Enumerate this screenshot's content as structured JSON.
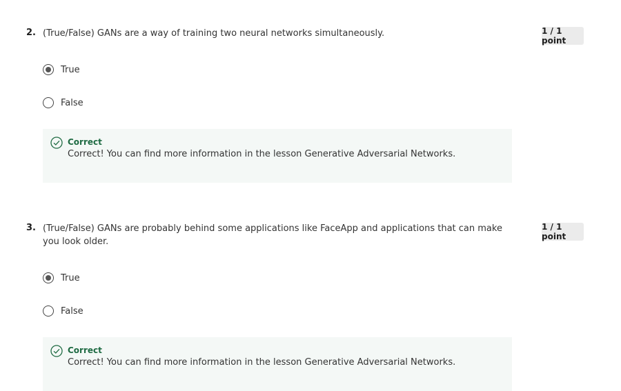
{
  "questions": [
    {
      "number": "2.",
      "text": "(True/False) GANs are a way of training two neural networks simultaneously.",
      "points": "1 / 1 point",
      "options": [
        {
          "label": "True",
          "selected": true
        },
        {
          "label": "False",
          "selected": false
        }
      ],
      "feedback": {
        "title": "Correct",
        "text": "Correct! You can find more information in the lesson Generative Adversarial Networks."
      }
    },
    {
      "number": "3.",
      "text": "(True/False) GANs are probably behind some applications like FaceApp and applications that can make you look older.",
      "points": "1 / 1 point",
      "options": [
        {
          "label": "True",
          "selected": true
        },
        {
          "label": "False",
          "selected": false
        }
      ],
      "feedback": {
        "title": "Correct",
        "text": "Correct! You can find more information in the lesson Generative Adversarial Networks."
      }
    }
  ],
  "colors": {
    "correct_green": "#1f6b43",
    "feedback_bg": "#f4f8f6",
    "points_bg": "#ebebeb"
  },
  "icons": {
    "feedback": "check-circle-icon"
  }
}
